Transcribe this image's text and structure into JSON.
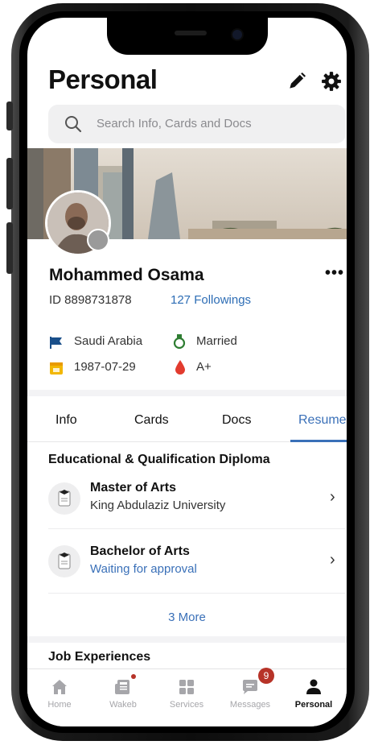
{
  "header": {
    "title": "Personal",
    "edit_icon": "pencil-icon",
    "settings_icon": "gear-icon"
  },
  "search": {
    "placeholder": "Search Info, Cards and Docs",
    "icon": "search-icon"
  },
  "profile": {
    "name": "Mohammed Osama",
    "id_label": "ID",
    "id_value": "8898731878",
    "followings": "127 Followings",
    "more_label": "•••",
    "country": "Saudi Arabia",
    "marital_status": "Married",
    "birth_date": "1987-07-29",
    "blood_type": "A+"
  },
  "tabs": [
    {
      "label": "Info",
      "active": false
    },
    {
      "label": "Cards",
      "active": false
    },
    {
      "label": "Docs",
      "active": false
    },
    {
      "label": "Resume",
      "active": true
    }
  ],
  "resume": {
    "education_title": "Educational & Qualification Diploma",
    "items": [
      {
        "title": "Master of Arts",
        "subtitle": "King Abdulaziz University",
        "status": "normal"
      },
      {
        "title": "Bachelor of Arts",
        "subtitle": "Waiting for approval",
        "status": "pending"
      }
    ],
    "more_link": "3 More",
    "job_title": "Job Experiences"
  },
  "tabbar": [
    {
      "label": "Home",
      "icon": "home-icon",
      "active": false
    },
    {
      "label": "Wakeb",
      "icon": "newspaper-icon",
      "active": false,
      "dot": true
    },
    {
      "label": "Services",
      "icon": "grid-icon",
      "active": false
    },
    {
      "label": "Messages",
      "icon": "chat-icon",
      "active": false,
      "badge": "9"
    },
    {
      "label": "Personal",
      "icon": "person-icon",
      "active": true
    }
  ],
  "colors": {
    "accent": "#3a70b8",
    "badge": "#b73328",
    "text": "#111111"
  }
}
